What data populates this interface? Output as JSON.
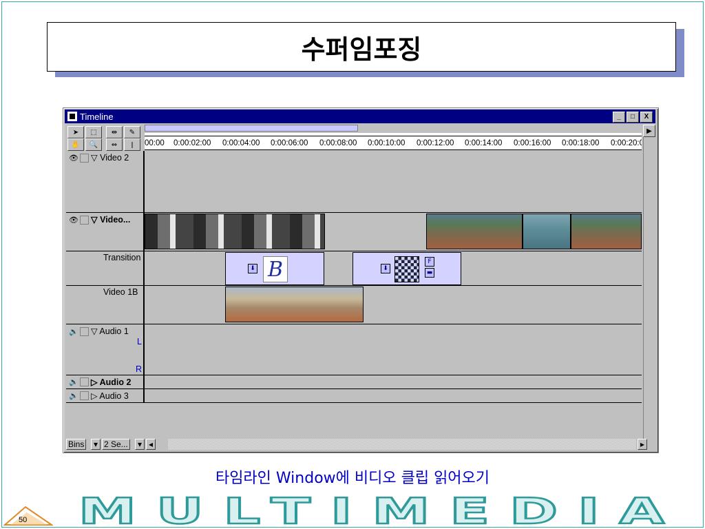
{
  "slide": {
    "title": "수퍼임포징",
    "caption": "타임라인 Window에 비디오 클립 읽어오기",
    "brand": "MULTIMEDIA",
    "page_number": "50"
  },
  "window": {
    "title": "Timeline",
    "controls": [
      "_",
      "□",
      "X"
    ]
  },
  "ruler": {
    "ticks": [
      "00:00",
      "0:00:02:00",
      "0:00:04:00",
      "0:00:06:00",
      "0:00:08:00",
      "0:00:10:00",
      "0:00:12:00",
      "0:00:14:00",
      "0:00:16:00",
      "0:00:18:00",
      "0:00:20:0"
    ]
  },
  "tracks": {
    "video2": "Video 2",
    "video1": "Video...",
    "transition": "Transition",
    "video1b": "Video 1B",
    "audio1": "Audio 1",
    "audio1_l": "L",
    "audio1_r": "R",
    "audio2": "Audio 2",
    "audio3": "Audio 3"
  },
  "bottom_bar": {
    "bins": "Bins",
    "segments": "2 Se..."
  },
  "colors": {
    "titlebar": "#000082",
    "accent_blue": "#0000c8",
    "transition_fill": "#d4d2ff"
  }
}
